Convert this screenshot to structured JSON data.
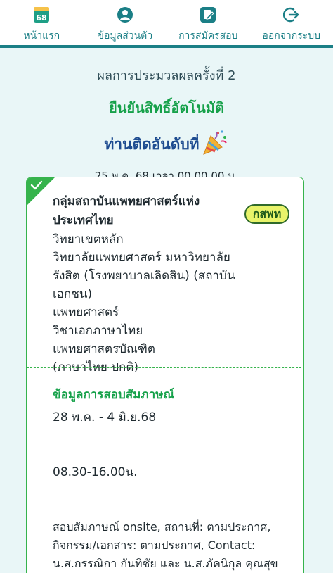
{
  "nav": {
    "items": [
      {
        "label": "หน้าแรก",
        "icon": "home-book-icon"
      },
      {
        "label": "ข้อมูลส่วนตัว",
        "icon": "user-icon"
      },
      {
        "label": "การสมัครสอบ",
        "icon": "edit-form-icon"
      },
      {
        "label": "ออกจากระบบ",
        "icon": "logout-icon"
      }
    ],
    "home_icon_text": "68"
  },
  "result": {
    "round": "ผลการประมวลผลครั้งที่ 2",
    "confirm": "ยืนยันสิทธิ์อัตโนมัติ",
    "rank": "ท่านติดอันดับที่",
    "date": "25 พ.ค. 68 เวลา 00.00.00 น."
  },
  "card": {
    "program_lines": [
      "กลุ่มสถาบันแพทยศาสตร์แห่ง",
      "ประเทศไทย",
      "วิทยาเขตหลัก",
      "วิทยาลัยแพทยศาสตร์ มหาวิทยาลัย",
      "รังสิต (โรงพยาบาลเลิดสิน) (สถาบันเอกชน)",
      "แพทยศาสตร์",
      "วิชาเอกภาษาไทย",
      "แพทยศาสตรบัณฑิต",
      "(ภาษาไทย ปกติ)"
    ],
    "badge": "กสพท",
    "interview_title": "ข้อมูลการสอบสัมภาษณ์",
    "interview_date": "28 พ.ค. - 4 มิ.ย.68",
    "interview_time": "08.30-16.00น.",
    "interview_detail_lines": [
      "สอบสัมภาษณ์ onsite, สถานที่: ตามประกาศ,",
      "กิจกรรม/เอกสาร: ตามประกาศ, Contact:",
      "น.ส.กรรณิกา กันทิชัย และ น.ส.ภัคนิกุล คุณสุข"
    ]
  },
  "colors": {
    "teal": "#1b7f86",
    "green": "#16a14a",
    "navy": "#1d4b90"
  }
}
